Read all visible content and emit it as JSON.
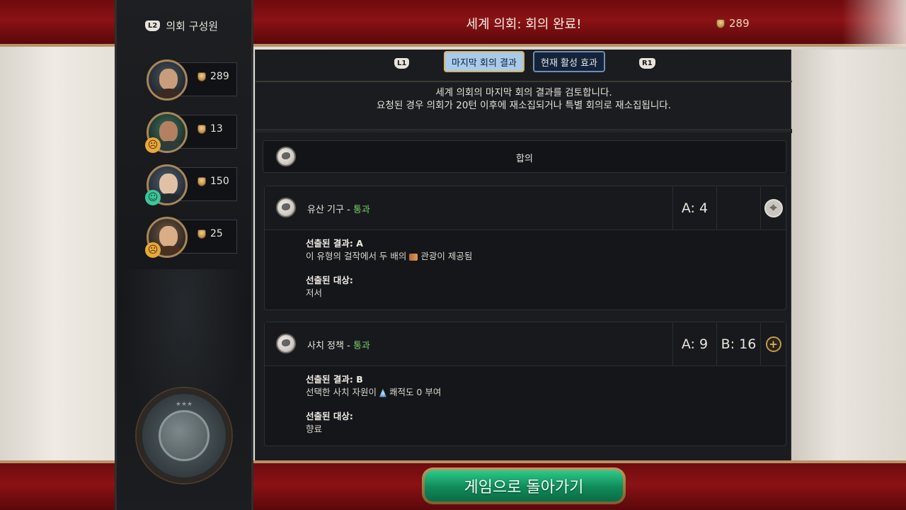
{
  "header": {
    "title": "세계 의회: 회의 완료!",
    "favor_total": "289"
  },
  "left_panel": {
    "button_hint": "L2",
    "title": "의회 구성원",
    "members": [
      {
        "score": "289",
        "mood": ""
      },
      {
        "score": "13",
        "mood": "angry"
      },
      {
        "score": "150",
        "mood": "happy"
      },
      {
        "score": "25",
        "mood": "angry"
      }
    ]
  },
  "tabs": {
    "hint_left": "L1",
    "hint_right": "R1",
    "items": [
      {
        "label": "마지막 회의 결과",
        "active": true
      },
      {
        "label": "현재 활성 효과",
        "active": false
      }
    ]
  },
  "description": {
    "line1": "세계 의회의 마지막 회의 결과를 검토합니다.",
    "line2": "요청된 경우 의회가 20턴 이후에 재소집되거나 특별 회의로 재소집됩니다."
  },
  "section": {
    "label": "합의"
  },
  "resolutions": [
    {
      "name": "유산 기구",
      "separator": " - ",
      "status": "통과",
      "votes": [
        {
          "label": "A: 4"
        }
      ],
      "outcome_label": "선출된 결과: A",
      "outcome_text_before": "이 유형의 걸작에서 두 배의",
      "outcome_icon": "tourism-icon",
      "outcome_text_after": "관광이 제공됨",
      "target_label": "선출된 대상:",
      "target_value": "저서"
    },
    {
      "name": "사치 정책",
      "separator": " - ",
      "status": "통과",
      "votes": [
        {
          "label": "A: 9"
        },
        {
          "label": "B: 16"
        }
      ],
      "outcome_label": "선출된 결과: B",
      "outcome_text_before": "선택한 사치 자원이",
      "outcome_icon": "amenity-icon",
      "outcome_text_after": "쾌적도 0 부여",
      "target_label": "선출된 대상:",
      "target_value": "향료"
    }
  ],
  "footer": {
    "return_button": "게임으로 돌아가기"
  },
  "colors": {
    "band_red": "#8b1215",
    "passed_green": "#7ccf6b",
    "active_tab": "#a9cbe9",
    "return_button": "#1aa56e"
  }
}
